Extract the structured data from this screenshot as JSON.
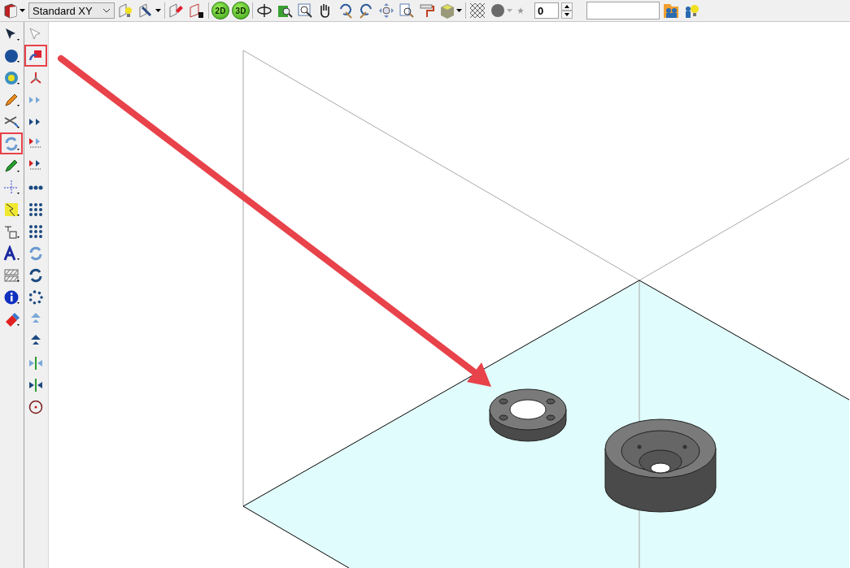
{
  "toolbar": {
    "view_select": "Standard XY",
    "mode_buttons": [
      {
        "label": "2D"
      },
      {
        "label": "3D"
      }
    ],
    "layer_spinner": "0"
  },
  "left_palette": [
    {
      "kind": "select",
      "highlighted": false
    },
    {
      "kind": "sphere",
      "highlighted": false
    },
    {
      "kind": "swirl",
      "highlighted": false
    },
    {
      "kind": "pencil",
      "highlighted": false
    },
    {
      "kind": "trim",
      "highlighted": false
    },
    {
      "kind": "rotate-light",
      "highlighted": true
    },
    {
      "kind": "marker",
      "highlighted": false
    },
    {
      "kind": "crosshair",
      "highlighted": false
    },
    {
      "kind": "dimension",
      "highlighted": false
    },
    {
      "kind": "label",
      "highlighted": false
    },
    {
      "kind": "text",
      "highlighted": false
    },
    {
      "kind": "hatch",
      "highlighted": false
    },
    {
      "kind": "info",
      "highlighted": false
    },
    {
      "kind": "eraser",
      "highlighted": false
    }
  ],
  "right_palette": [
    {
      "kind": "select-outline",
      "highlighted": false
    },
    {
      "kind": "transform",
      "highlighted": true
    },
    {
      "kind": "triad",
      "highlighted": false
    },
    {
      "kind": "move-light",
      "highlighted": false
    },
    {
      "kind": "move-dark",
      "highlighted": false
    },
    {
      "kind": "copy-light",
      "highlighted": false
    },
    {
      "kind": "copy-dark",
      "highlighted": false
    },
    {
      "kind": "dots-row",
      "highlighted": false
    },
    {
      "kind": "dot-grid",
      "highlighted": false
    },
    {
      "kind": "dot-grid",
      "highlighted": false
    },
    {
      "kind": "rotate-light",
      "highlighted": false
    },
    {
      "kind": "rotate-dark",
      "highlighted": false
    },
    {
      "kind": "dot-circle",
      "highlighted": false
    },
    {
      "kind": "up-light",
      "highlighted": false
    },
    {
      "kind": "up-dark",
      "highlighted": false
    },
    {
      "kind": "mirror-light",
      "highlighted": false
    },
    {
      "kind": "mirror-dark",
      "highlighted": false
    },
    {
      "kind": "target",
      "highlighted": false
    }
  ]
}
